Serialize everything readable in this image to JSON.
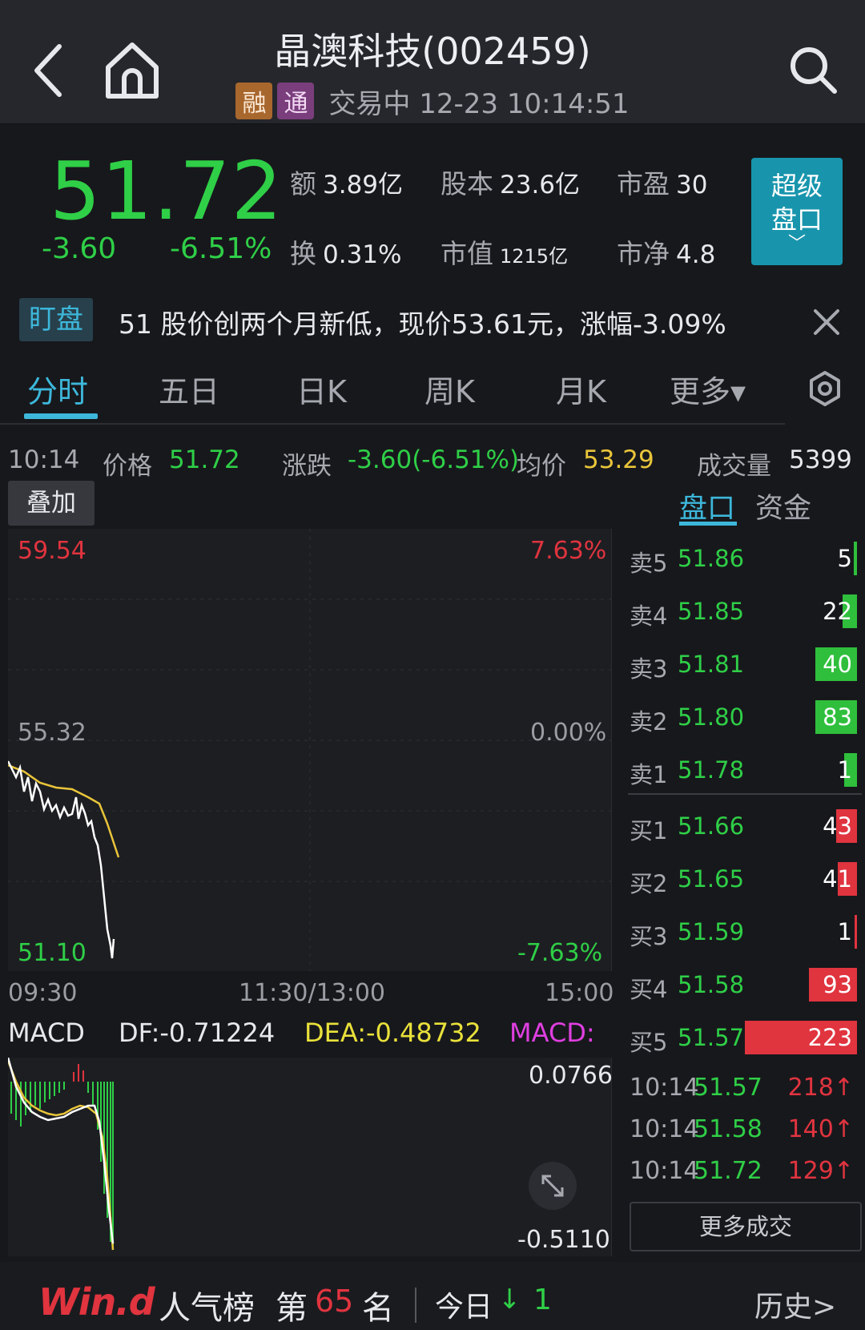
{
  "header": {
    "title": "晶澳科技(002459)",
    "badges": [
      "融",
      "通"
    ],
    "trade_status": "交易中 12-23 10:14:51",
    "icons": {
      "back": "back-chevron-icon",
      "home": "home-icon",
      "search": "search-icon"
    }
  },
  "quote": {
    "price": "51.72",
    "change": "-3.60",
    "change_pct": "-6.51%",
    "metrics": [
      {
        "label": "额",
        "value": "3.89亿"
      },
      {
        "label": "股本",
        "value": "23.6亿"
      },
      {
        "label": "市盈",
        "value": "30"
      },
      {
        "label": "换",
        "value": "0.31%"
      },
      {
        "label": "市值",
        "value": "1215亿"
      },
      {
        "label": "市净",
        "value": "4.8"
      }
    ],
    "super_button": {
      "line1": "超级",
      "line2": "盘口",
      "chevron": "﹀"
    }
  },
  "alert": {
    "tag": "盯盘",
    "text": "51 股价创两个月新低，现价53.61元，涨幅-3.09%"
  },
  "tabs": [
    {
      "label": "分时",
      "active": true
    },
    {
      "label": "五日",
      "active": false
    },
    {
      "label": "日K",
      "active": false
    },
    {
      "label": "周K",
      "active": false
    },
    {
      "label": "月K",
      "active": false
    },
    {
      "label": "更多▾",
      "active": false
    }
  ],
  "info": {
    "time": "10:14",
    "price_label": "价格",
    "price": "51.72",
    "change_label": "涨跌",
    "change": "-3.60(-6.51%)",
    "avg_label": "均价",
    "avg": "53.29",
    "volume_label": "成交量",
    "volume": "5399"
  },
  "overlay_button": "叠加",
  "side_tabs": {
    "pankou": "盘口",
    "zijin": "资金"
  },
  "chart": {
    "price_high": "59.54",
    "price_mid": "55.32",
    "price_low": "51.10",
    "pct_high": "7.63%",
    "pct_mid": "0.00%",
    "pct_low": "-7.63%",
    "time_start": "09:30",
    "time_mid": "11:30/13:00",
    "time_end": "15:00",
    "price_line_color": "#ffffff",
    "avg_line_color": "#e9c53a"
  },
  "macd": {
    "label": "MACD",
    "df": "DF:-0.71224",
    "dea": "DEA:-0.48732",
    "macd": "MACD:",
    "top": "0.0766",
    "bottom": "-0.5110"
  },
  "order_book": {
    "asks": [
      {
        "label": "卖5",
        "price": "51.86",
        "volume": "5"
      },
      {
        "label": "卖4",
        "price": "51.85",
        "volume": "22"
      },
      {
        "label": "卖3",
        "price": "51.81",
        "volume": "40"
      },
      {
        "label": "卖2",
        "price": "51.80",
        "volume": "83"
      },
      {
        "label": "卖1",
        "price": "51.78",
        "volume": "1"
      }
    ],
    "bids": [
      {
        "label": "买1",
        "price": "51.66",
        "volume": "43"
      },
      {
        "label": "买2",
        "price": "51.65",
        "volume": "41"
      },
      {
        "label": "买3",
        "price": "51.59",
        "volume": "1"
      },
      {
        "label": "买4",
        "price": "51.58",
        "volume": "93"
      },
      {
        "label": "买5",
        "price": "51.57",
        "volume": "223"
      }
    ]
  },
  "ticks": [
    {
      "time": "10:14",
      "price": "51.57",
      "volume": "218↑"
    },
    {
      "time": "10:14",
      "price": "51.58",
      "volume": "140↑"
    },
    {
      "time": "10:14",
      "price": "51.72",
      "volume": "129↑"
    }
  ],
  "more_trades": "更多成交",
  "footer": {
    "logo": "Win.d",
    "popularity_label": "人气榜",
    "rank_prefix": "第",
    "rank": "65",
    "rank_suffix": "名",
    "today_label": "今日",
    "today_arrow": "↓",
    "today_value": "1",
    "history": "历史>"
  }
}
